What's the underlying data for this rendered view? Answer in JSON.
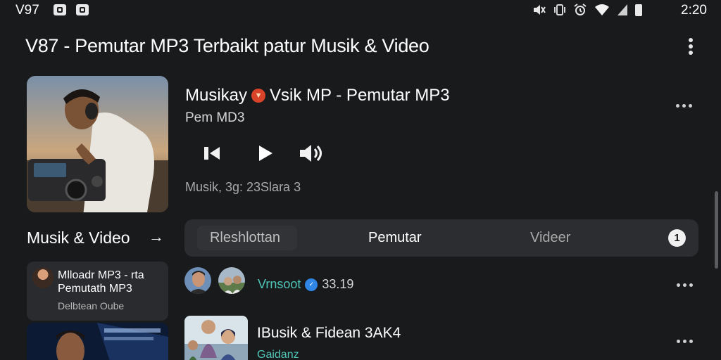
{
  "status_bar": {
    "carrier": "V97",
    "icons": [
      "notification-icon",
      "message-icon",
      "mute-icon",
      "vibrate-icon",
      "alarm-icon",
      "wifi-icon",
      "signal-icon",
      "battery-icon"
    ],
    "time": "2:20"
  },
  "header": {
    "title": "V87 - Pemutar MP3 Terbaikt patur Musik & Video",
    "menu_icon": "more-vertical-icon"
  },
  "now_playing": {
    "title": "Musikay",
    "title_rest": "Vsik MP - Pemutar MP3",
    "subtitle": "Pem MD3",
    "meta": "Musik, 3g: 23Slara 3",
    "controls": [
      "previous-icon",
      "play-icon",
      "volume-icon"
    ]
  },
  "left_panel": {
    "section_title": "Musik & Video",
    "arrow": "→",
    "card": {
      "title": "Mlloadr MP3 - rta Pemutath MP3",
      "subtitle": "Delbtean Oube"
    }
  },
  "tabs": {
    "items": [
      {
        "label": "Rleshlottan",
        "active": false
      },
      {
        "label": "Pemutar",
        "active": true
      },
      {
        "label": "Videer",
        "active": false
      }
    ],
    "count": "1"
  },
  "list": {
    "row1": {
      "name": "Vrnsoot",
      "count": "33.19"
    },
    "row2": {
      "title": "IBusik & Fidean 3AK4",
      "subtitle": "Gaidanz"
    }
  },
  "colors": {
    "background": "#191a1c",
    "accent_teal": "#4fc7b8",
    "badge_blue": "#2f86e4",
    "badge_red": "#d9432a"
  }
}
